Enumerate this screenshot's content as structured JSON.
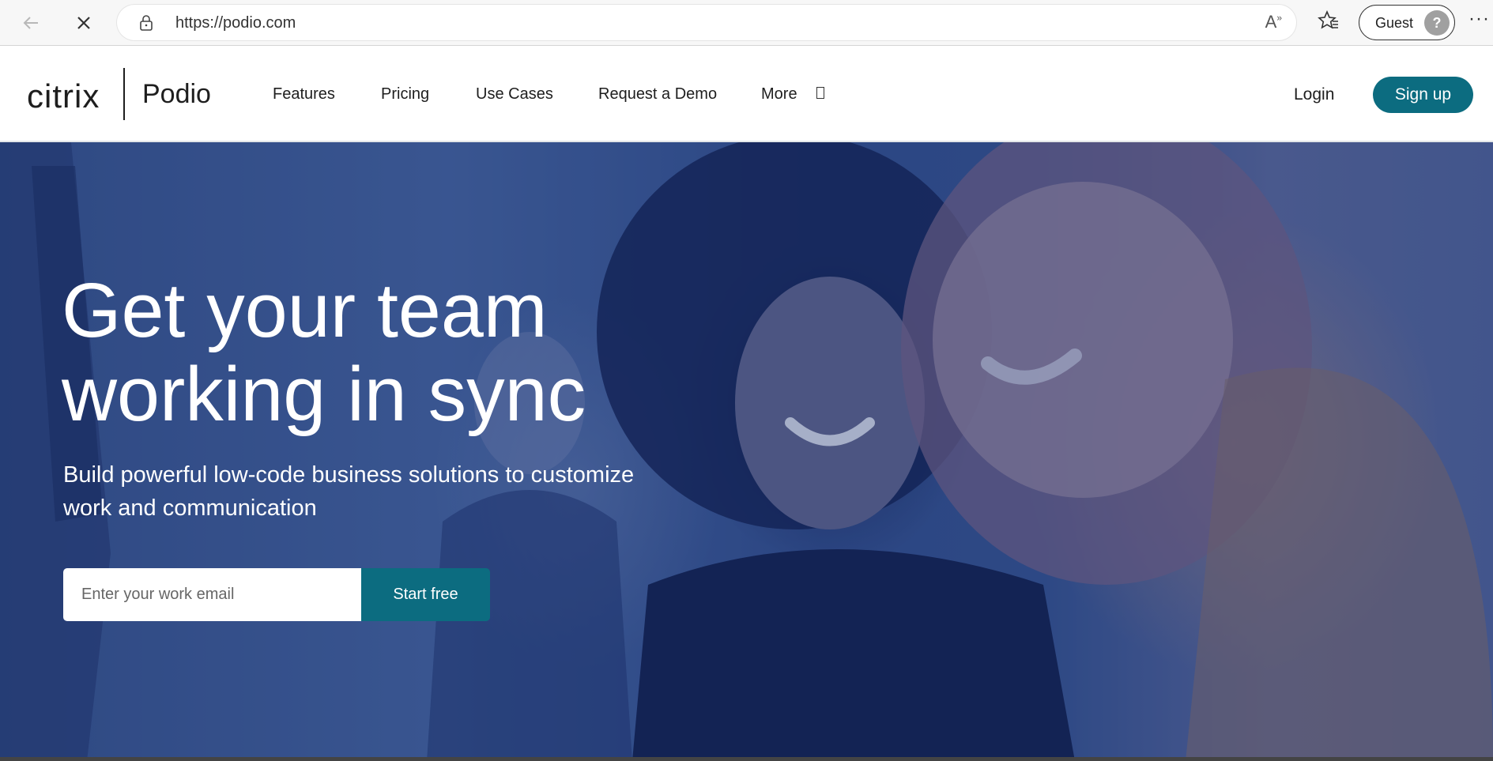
{
  "browser": {
    "url": "https://podio.com",
    "profile_label": "Guest",
    "icons": [
      "back-icon",
      "stop-icon",
      "lock-icon",
      "read-aloud-icon",
      "favorites-icon",
      "profile-icon",
      "more-icon"
    ]
  },
  "header": {
    "brand_citrix": "citrix",
    "brand_podio": "Podio",
    "nav": {
      "features": "Features",
      "pricing": "Pricing",
      "use_cases": "Use Cases",
      "request_demo": "Request a Demo",
      "more": "More"
    },
    "login": "Login",
    "signup": "Sign up"
  },
  "hero": {
    "title_line1": "Get your team",
    "title_line2": "working in sync",
    "subtitle_line1": "Build powerful low-code business solutions to customize",
    "subtitle_line2": "work and communication",
    "email_placeholder": "Enter your work email",
    "cta": "Start free"
  },
  "colors": {
    "accent": "#0c6c80",
    "hero_overlay": "#162c6e"
  }
}
